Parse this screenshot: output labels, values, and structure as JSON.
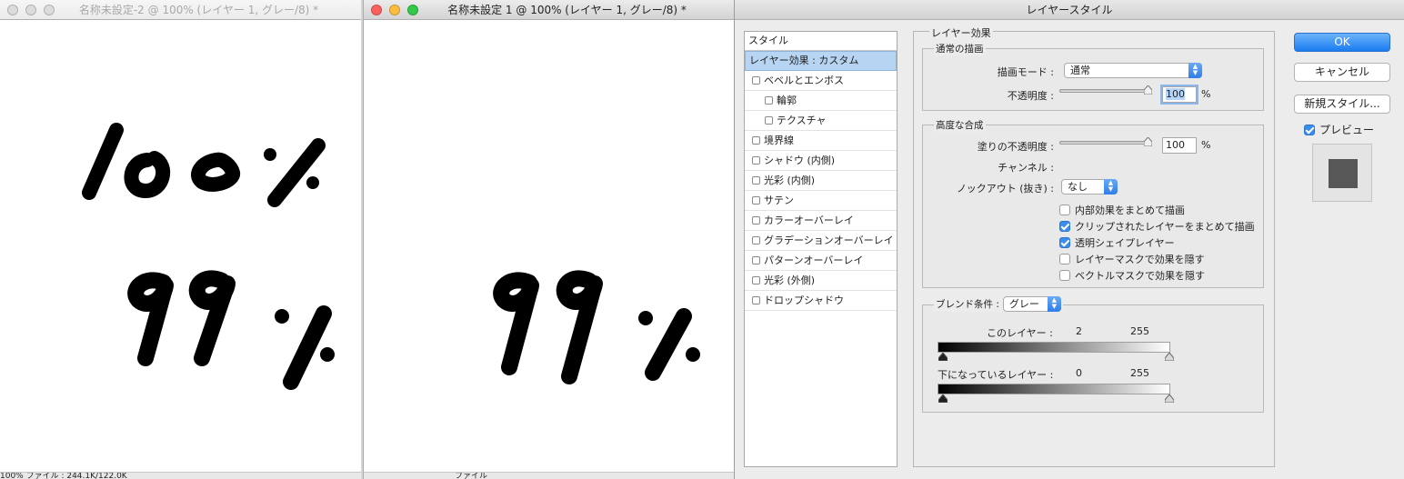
{
  "window_left": {
    "title": "名称未設定-2 @ 100% (レイヤー 1, グレー/8) *",
    "statusbar_text": "100%        ファイル : 244.1K/122.0K"
  },
  "window_middle": {
    "title": "名称未設定 1 @ 100% (レイヤー 1, グレー/8) *",
    "statusbar_text": "ファイル"
  },
  "dialog": {
    "title": "レイヤースタイル",
    "style_list": {
      "header": "スタイル",
      "items": [
        {
          "label": "レイヤー効果 : カスタム",
          "selected": true,
          "checkbox": false
        },
        {
          "label": "ベベルとエンボス",
          "checkbox": true
        },
        {
          "label": "輪郭",
          "checkbox": true,
          "sub": true
        },
        {
          "label": "テクスチャ",
          "checkbox": true,
          "sub": true
        },
        {
          "label": "境界線",
          "checkbox": true
        },
        {
          "label": "シャドウ (内側)",
          "checkbox": true
        },
        {
          "label": "光彩 (内側)",
          "checkbox": true
        },
        {
          "label": "サテン",
          "checkbox": true
        },
        {
          "label": "カラーオーバーレイ",
          "checkbox": true
        },
        {
          "label": "グラデーションオーバーレイ",
          "checkbox": true
        },
        {
          "label": "パターンオーバーレイ",
          "checkbox": true
        },
        {
          "label": "光彩 (外側)",
          "checkbox": true
        },
        {
          "label": "ドロップシャドウ",
          "checkbox": true
        }
      ]
    },
    "effects": {
      "panel_title": "レイヤー効果",
      "normal_blend": {
        "title": "通常の描画",
        "blend_mode_label": "描画モード :",
        "blend_mode_value": "通常",
        "opacity_label": "不透明度 :",
        "opacity_value": "100",
        "percent": "%"
      },
      "advanced_blend": {
        "title": "高度な合成",
        "fill_opacity_label": "塗りの不透明度 :",
        "fill_opacity_value": "100",
        "percent": "%",
        "channels_label": "チャンネル :",
        "knockout_label": "ノックアウト (抜き) :",
        "knockout_value": "なし",
        "options": [
          {
            "label": "内部効果をまとめて描画",
            "checked": false
          },
          {
            "label": "クリップされたレイヤーをまとめて描画",
            "checked": true
          },
          {
            "label": "透明シェイプレイヤー",
            "checked": true
          },
          {
            "label": "レイヤーマスクで効果を隠す",
            "checked": false
          },
          {
            "label": "ベクトルマスクで効果を隠す",
            "checked": false
          }
        ]
      },
      "blend_if": {
        "label": "ブレンド条件 :",
        "value": "グレー",
        "this_layer_label": "このレイヤー :",
        "this_layer_low": "2",
        "this_layer_high": "255",
        "underlying_label": "下になっているレイヤー :",
        "underlying_low": "0",
        "underlying_high": "255"
      }
    },
    "buttons": {
      "ok": "OK",
      "cancel": "キャンセル",
      "new_style": "新規スタイル...",
      "preview": "プレビュー"
    }
  }
}
